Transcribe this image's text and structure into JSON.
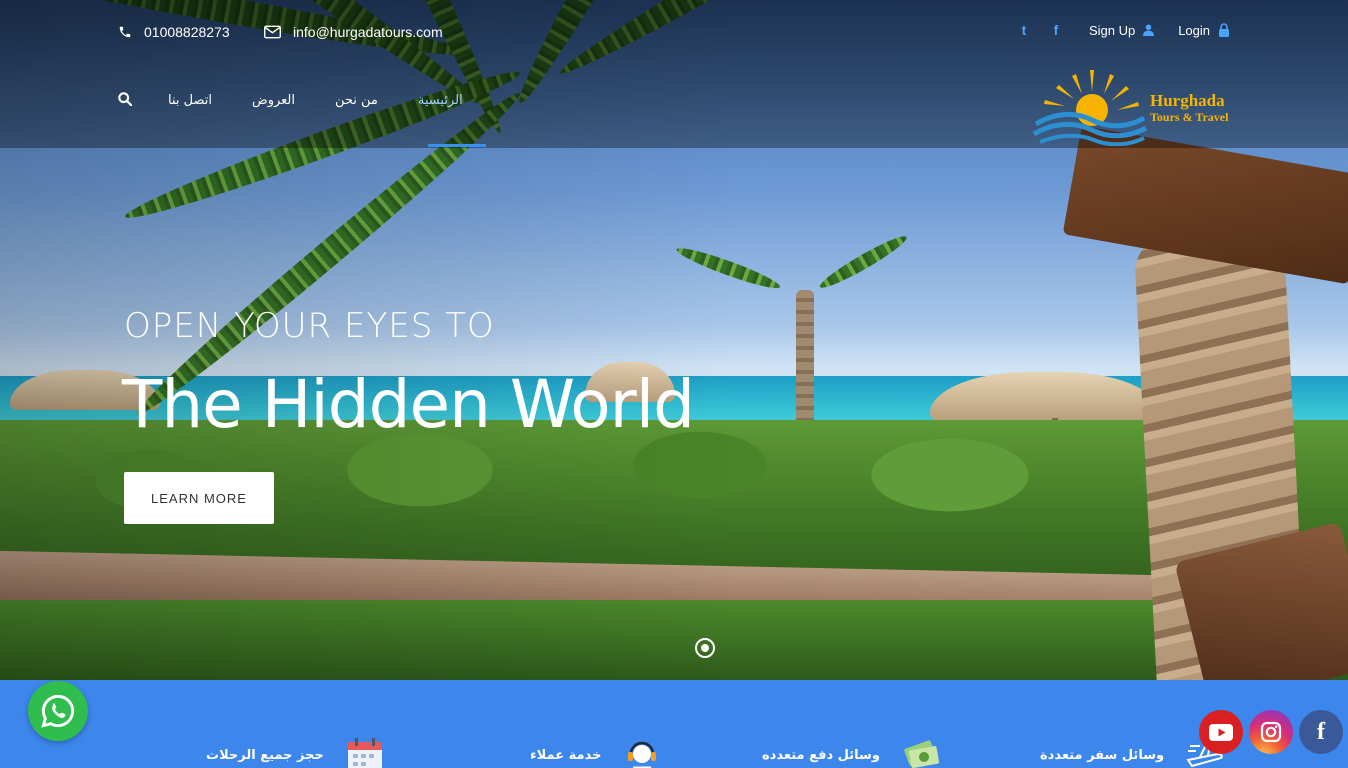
{
  "header": {
    "phone": "01008828273",
    "email": "info@hurgadatours.com",
    "social_top": [
      {
        "icon": "twitter-icon",
        "glyph": "t"
      },
      {
        "icon": "facebook-icon",
        "glyph": "f"
      }
    ],
    "signup_label": "Sign Up",
    "login_label": "Login"
  },
  "nav": {
    "items": [
      "اتصل بنا",
      "العروض",
      "من نحن",
      "الرئيسية"
    ],
    "active": "الرئيسية"
  },
  "logo": {
    "line1": "Hurghada",
    "line2": "Tours & Travel"
  },
  "hero": {
    "kicker": "OPEN YOUR EYES TO",
    "headline": "The Hidden World",
    "cta_label": "LEARN MORE"
  },
  "features": [
    {
      "label": "حجز جميع الرحلات",
      "icon": "calendar-icon"
    },
    {
      "label": "خدمة عملاء",
      "icon": "headset-icon"
    },
    {
      "label": "وسائل دفع متعدده",
      "icon": "money-icon"
    },
    {
      "label": "وسائل سفر متعددة",
      "icon": "plane-icon"
    }
  ],
  "floating": {
    "whatsapp_icon": "whatsapp-icon",
    "youtube_icon": "youtube-icon",
    "instagram_icon": "instagram-icon",
    "facebook_icon": "facebook-icon",
    "facebook_glyph": "f"
  },
  "colors": {
    "accent_blue": "#3d86eb",
    "nav_active": "#3a8ff0",
    "logo_gold": "#f6b400",
    "whatsapp": "#2fbe4e",
    "youtube": "#d91f1f",
    "facebook": "#3b5998"
  }
}
